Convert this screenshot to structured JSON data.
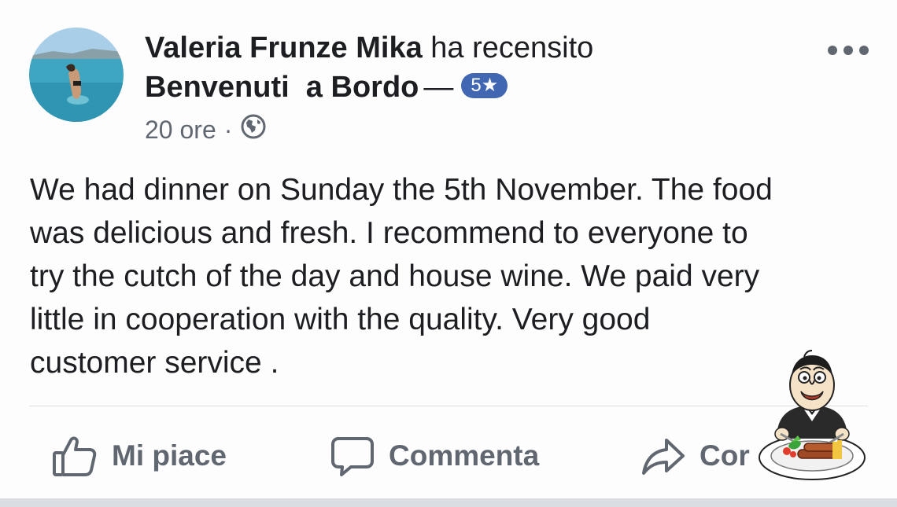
{
  "post": {
    "author": "Valeria Frunze Mika",
    "verb": "ha recensito",
    "place": "Benvenuti  a Bordo",
    "dash": "—",
    "rating": "5★",
    "time": "20 ore",
    "separator": "·",
    "audience_icon": "globe-icon",
    "more_icon": "more-options-icon",
    "body": [
      "We had dinner on Sunday the 5th November. The food",
      "was delicious and fresh. I recommend to everyone to",
      "try the cutch of the day and house wine. We paid very",
      "little in cooperation with the quality. Very good",
      "customer service ."
    ]
  },
  "actions": {
    "like": {
      "label": "Mi piace",
      "icon": "thumbs-up-icon"
    },
    "comment": {
      "label": "Commenta",
      "icon": "comment-icon"
    },
    "share": {
      "label": "Cor",
      "icon": "share-icon"
    }
  },
  "sticker": {
    "icon": "chef-eating-sticker-icon"
  },
  "colors": {
    "rating_badge": "#4267b2",
    "secondary_text": "#606770",
    "primary_text": "#1c1e21",
    "divider": "#dadde1"
  }
}
